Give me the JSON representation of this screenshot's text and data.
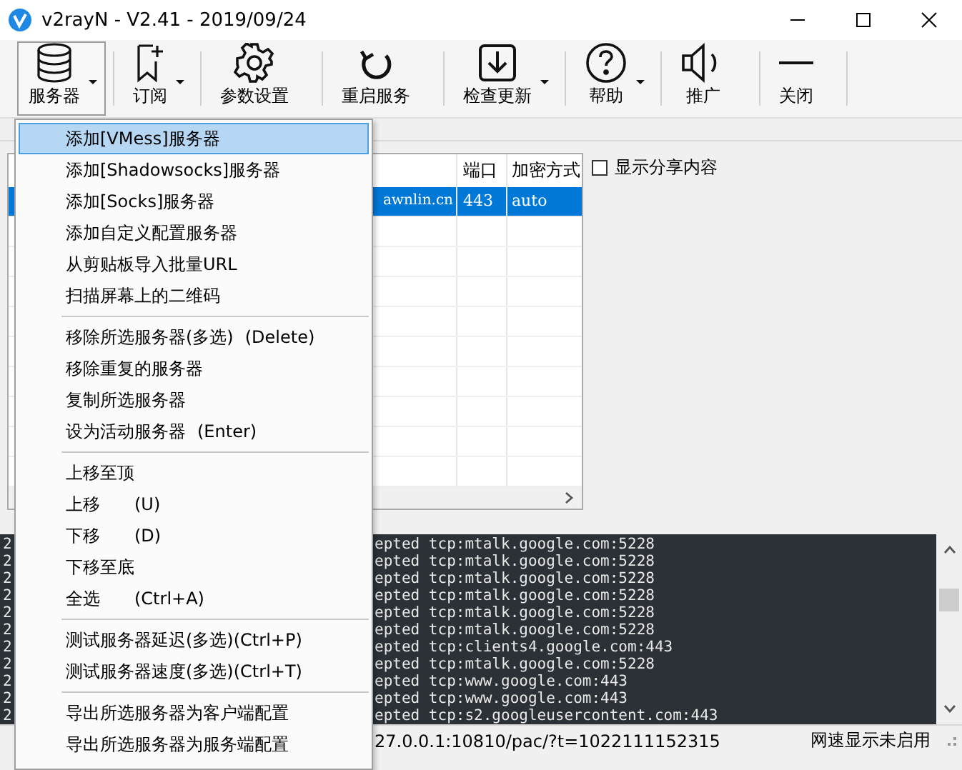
{
  "window": {
    "title": "v2rayN - V2.41 - 2019/09/24"
  },
  "toolbar": [
    {
      "label": "服务器",
      "dropdown": true,
      "selected": true
    },
    {
      "label": "订阅",
      "dropdown": true,
      "selected": false
    },
    {
      "label": "参数设置",
      "dropdown": false,
      "selected": false
    },
    {
      "label": "重启服务",
      "dropdown": false,
      "selected": false
    },
    {
      "label": "检查更新",
      "dropdown": true,
      "selected": false
    },
    {
      "label": "帮助",
      "dropdown": true,
      "selected": false
    },
    {
      "label": "推广",
      "dropdown": false,
      "selected": false
    },
    {
      "label": "关闭",
      "dropdown": false,
      "selected": false
    }
  ],
  "table": {
    "columns": [
      "端口",
      "加密方式"
    ],
    "rows": [
      {
        "address": "awnlin.cn",
        "port": "443",
        "security": "auto",
        "selected": true
      }
    ]
  },
  "share_checkbox": {
    "label": "显示分享内容",
    "checked": false
  },
  "log_lines": [
    {
      "start": "2",
      "end": "epted tcp:mtalk.google.com:5228"
    },
    {
      "start": "2",
      "end": "epted tcp:mtalk.google.com:5228"
    },
    {
      "start": "2",
      "end": "epted tcp:mtalk.google.com:5228"
    },
    {
      "start": "2",
      "end": "epted tcp:mtalk.google.com:5228"
    },
    {
      "start": "2",
      "end": "epted tcp:mtalk.google.com:5228"
    },
    {
      "start": "2",
      "end": "epted tcp:mtalk.google.com:5228"
    },
    {
      "start": "2",
      "end": "epted tcp:clients4.google.com:443"
    },
    {
      "start": "2",
      "end": "epted tcp:mtalk.google.com:5228"
    },
    {
      "start": "2",
      "end": "epted tcp:www.google.com:443"
    },
    {
      "start": "2",
      "end": "epted tcp:www.google.com:443"
    },
    {
      "start": "2",
      "end": "epted tcp:s2.googleusercontent.com:443"
    }
  ],
  "status_bar": {
    "address": "27.0.0.1:10810/pac/?t=1022111152315",
    "speed": "网速显示未启用"
  },
  "menu": [
    {
      "kind": "item",
      "label": "添加[VMess]服务器",
      "selected": true
    },
    {
      "kind": "item",
      "label": "添加[Shadowsocks]服务器",
      "selected": false
    },
    {
      "kind": "item",
      "label": "添加[Socks]服务器",
      "selected": false
    },
    {
      "kind": "item",
      "label": "添加自定义配置服务器",
      "selected": false
    },
    {
      "kind": "item",
      "label": "从剪贴板导入批量URL",
      "selected": false
    },
    {
      "kind": "item",
      "label": "扫描屏幕上的二维码",
      "selected": false
    },
    {
      "kind": "separator"
    },
    {
      "kind": "item",
      "label": "移除所选服务器(多选)",
      "shortcut": "(Delete)",
      "selected": false
    },
    {
      "kind": "item",
      "label": "移除重复的服务器",
      "selected": false
    },
    {
      "kind": "item",
      "label": "复制所选服务器",
      "selected": false
    },
    {
      "kind": "item",
      "label": "设为活动服务器",
      "shortcut": "(Enter)",
      "selected": false
    },
    {
      "kind": "separator"
    },
    {
      "kind": "item",
      "label": "上移至顶",
      "selected": false
    },
    {
      "kind": "item",
      "label": "上移",
      "shortcut": "(U)",
      "selected": false
    },
    {
      "kind": "item",
      "label": "下移",
      "shortcut": "(D)",
      "selected": false
    },
    {
      "kind": "item",
      "label": "下移至底",
      "selected": false
    },
    {
      "kind": "item",
      "label": "全选",
      "shortcut": "(Ctrl+A)",
      "selected": false
    },
    {
      "kind": "separator"
    },
    {
      "kind": "item",
      "label": "测试服务器延迟(多选)(Ctrl+P)",
      "selected": false
    },
    {
      "kind": "item",
      "label": "测试服务器速度(多选)(Ctrl+T)",
      "selected": false
    },
    {
      "kind": "separator"
    },
    {
      "kind": "item",
      "label": "导出所选服务器为客户端配置",
      "selected": false
    },
    {
      "kind": "item",
      "label": "导出所选服务器为服务端配置",
      "selected": false
    }
  ]
}
